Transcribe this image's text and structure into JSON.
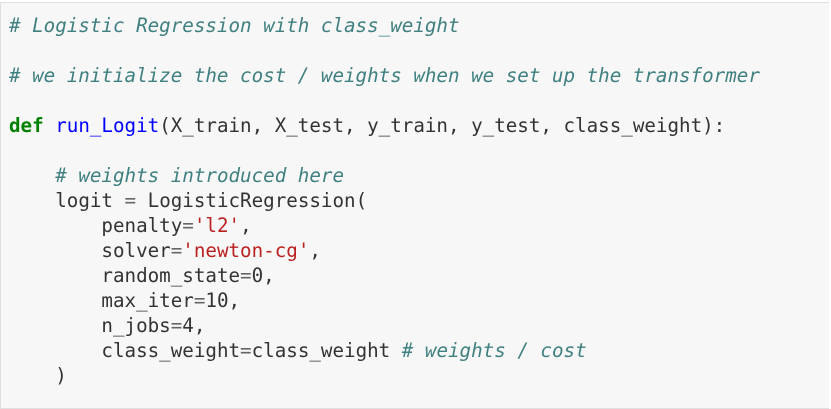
{
  "code_cell": {
    "comment_title": "# Logistic Regression with class_weight",
    "comment_init": "# we initialize the cost / weights when we set up the transformer",
    "def_keyword": "def",
    "func_name": "run_Logit",
    "func_params": "(X_train, X_test, y_train, y_test, class_weight):",
    "indent1": "    ",
    "indent2": "        ",
    "comment_weights": "# weights introduced here",
    "logit_var": "logit",
    "logit_eq": " = ",
    "logit_call": "LogisticRegression(",
    "penalty_key": "penalty",
    "penalty_val": "'l2'",
    "solver_key": "solver",
    "solver_val": "'newton-cg'",
    "random_state_key": "random_state",
    "random_state_val": "0",
    "max_iter_key": "max_iter",
    "max_iter_val": "10",
    "n_jobs_key": "n_jobs",
    "n_jobs_val": "4",
    "class_weight_key": "class_weight",
    "class_weight_val": "class_weight",
    "comment_cost": "# weights / cost",
    "eq": "=",
    "comma": ",",
    "space": " ",
    "close_paren": ")"
  }
}
